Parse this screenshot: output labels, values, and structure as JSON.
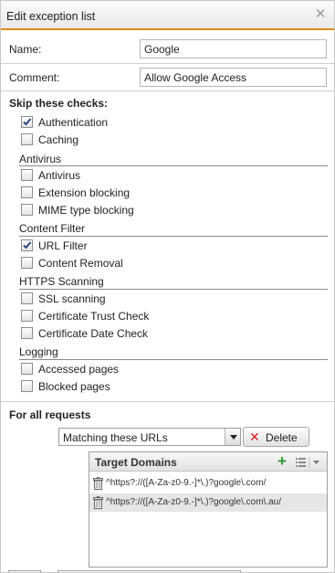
{
  "dialog": {
    "title": "Edit exception list"
  },
  "form": {
    "name_label": "Name:",
    "name_value": "Google",
    "comment_label": "Comment:",
    "comment_value": "Allow Google Access"
  },
  "skip": {
    "heading": "Skip these checks:",
    "top_items": [
      {
        "label": "Authentication",
        "checked": true
      },
      {
        "label": "Caching",
        "checked": false
      }
    ],
    "groups": [
      {
        "title": "Antivirus",
        "items": [
          {
            "label": "Antivirus",
            "checked": false
          },
          {
            "label": "Extension blocking",
            "checked": false
          },
          {
            "label": "MIME type blocking",
            "checked": false
          }
        ]
      },
      {
        "title": "Content Filter",
        "items": [
          {
            "label": "URL Filter",
            "checked": true
          },
          {
            "label": "Content Removal",
            "checked": false
          }
        ]
      },
      {
        "title": "HTTPS Scanning",
        "items": [
          {
            "label": "SSL scanning",
            "checked": false
          },
          {
            "label": "Certificate Trust Check",
            "checked": false
          },
          {
            "label": "Certificate Date Check",
            "checked": false
          }
        ]
      },
      {
        "title": "Logging",
        "items": [
          {
            "label": "Accessed pages",
            "checked": false
          },
          {
            "label": "Blocked pages",
            "checked": false
          }
        ]
      }
    ]
  },
  "requests": {
    "heading": "For all requests",
    "match_selected": "Matching these URLs",
    "delete_label": "Delete",
    "grid_title": "Target Domains",
    "rows": [
      {
        "pattern": "^https?://([A-Za-z0-9.-]*\\.)?google\\.com/",
        "selected": false
      },
      {
        "pattern": "^https?://([A-Za-z0-9.-]*\\.)?google\\.com\\.au/",
        "selected": true
      }
    ]
  },
  "icons": {
    "close": "close-icon",
    "checkmark": "checkmark-icon",
    "delete": "x-icon",
    "add": "plus-icon",
    "columns_menu": "list-menu-icon",
    "row_delete": "trash-icon",
    "dropdown": "chevron-down-icon"
  },
  "colors": {
    "title_accent": "#e08a1e",
    "delete_red": "#d21e1e",
    "add_green": "#2e9b2e",
    "selected_row": "#e6e6e6"
  }
}
